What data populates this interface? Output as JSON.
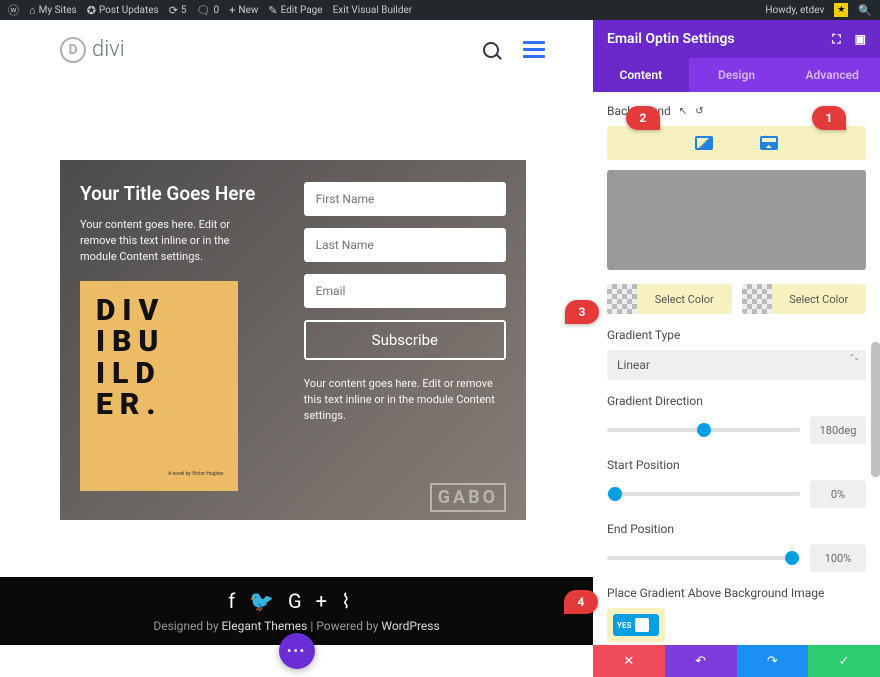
{
  "wpbar": {
    "mysites": "My Sites",
    "updates": "Post Updates",
    "count1": "5",
    "count2": "0",
    "new": "New",
    "edit": "Edit Page",
    "exit": "Exit Visual Builder",
    "howdy": "Howdy, etdev"
  },
  "header": {
    "logo": "divi"
  },
  "optin": {
    "title": "Your Title Goes Here",
    "desc": "Your content goes here. Edit or remove this text inline or in the module Content settings.",
    "book_line1": "DIV",
    "book_line2": "IBU",
    "book_line3": "ILD",
    "book_line4": "ER.",
    "book_sub": "A novel by Victor Hughes",
    "first_name": "First Name",
    "last_name": "Last Name",
    "email": "Email",
    "subscribe": "Subscribe",
    "desc2": "Your content goes here. Edit or remove this text inline or in the module Content settings.",
    "gabo": "GABO"
  },
  "footer": {
    "designed": "Designed by ",
    "theme": "Elegant Themes",
    "powered": " | Powered by ",
    "wp": "WordPress"
  },
  "sidebar": {
    "title": "Email Optin Settings",
    "tabs": {
      "content": "Content",
      "design": "Design",
      "advanced": "Advanced"
    },
    "bg_label": "Background",
    "select_color": "Select Color",
    "gradient_type_label": "Gradient Type",
    "gradient_type_value": "Linear",
    "gradient_dir_label": "Gradient Direction",
    "gradient_dir_value": "180deg",
    "start_label": "Start Position",
    "start_value": "0%",
    "end_label": "End Position",
    "end_value": "100%",
    "place_label": "Place Gradient Above Background Image",
    "toggle_value": "YES"
  },
  "callouts": {
    "c1": "1",
    "c2": "2",
    "c3": "3",
    "c4": "4"
  }
}
